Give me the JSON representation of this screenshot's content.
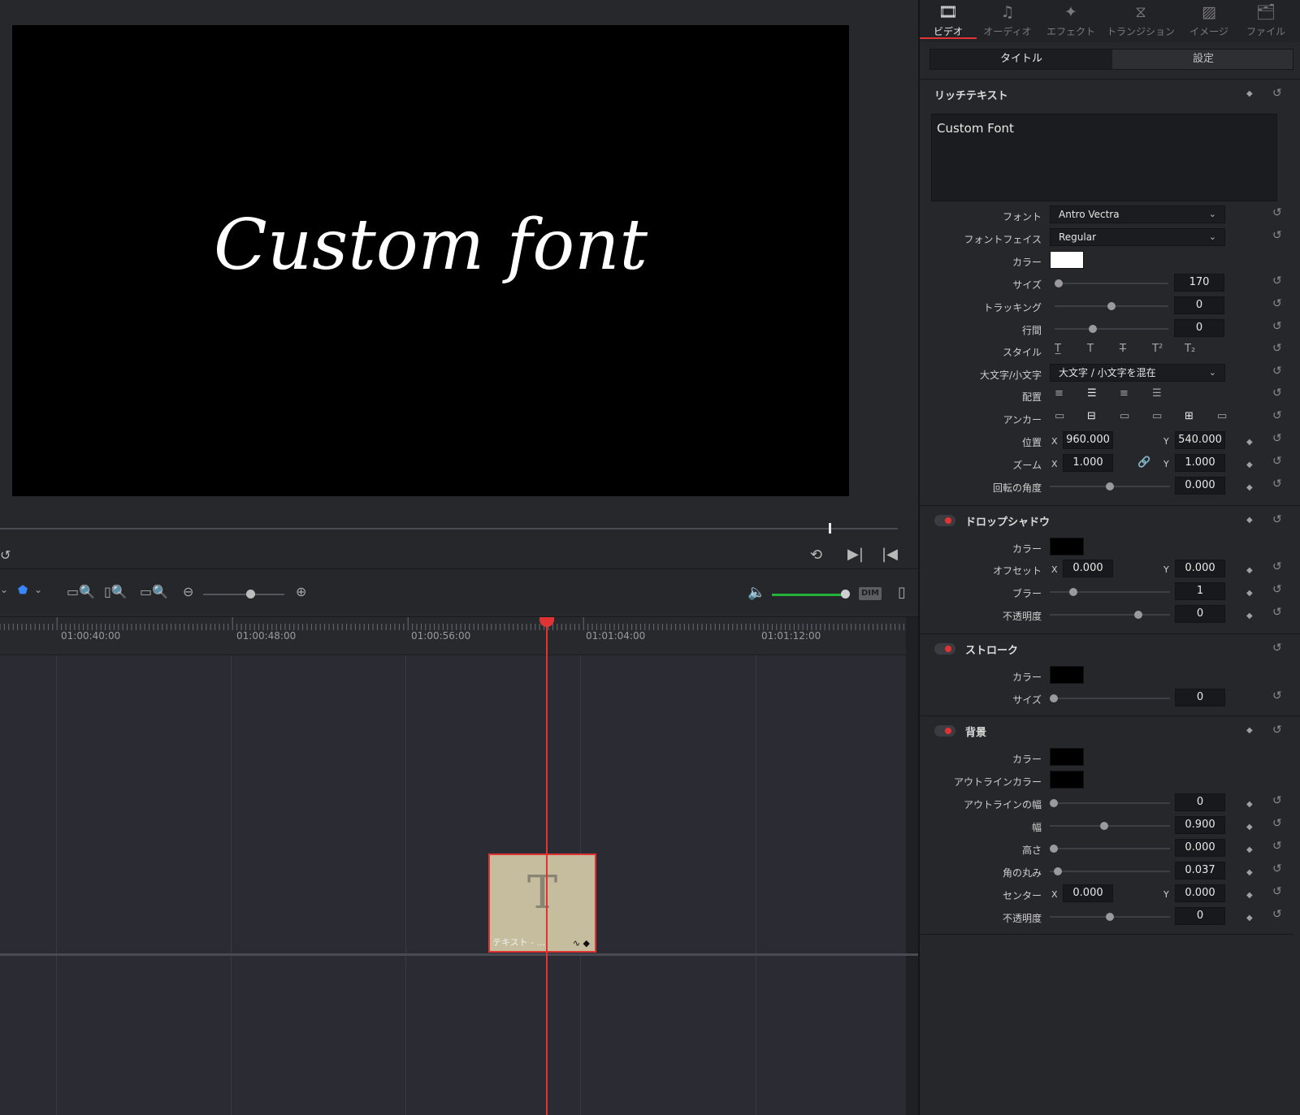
{
  "viewer": {
    "preview_text": "Custom font"
  },
  "timeline": {
    "ruler_labels": [
      "01:00:40:00",
      "01:00:48:00",
      "01:00:56:00",
      "01:01:04:00",
      "01:01:12:00"
    ],
    "clip": {
      "glyph": "T",
      "label": "テキスト - ..."
    },
    "dim_label": "DIM"
  },
  "tabs": [
    {
      "label": "ビデオ",
      "icon": "film-icon",
      "active": true
    },
    {
      "label": "オーディオ",
      "icon": "music-note-icon"
    },
    {
      "label": "エフェクト",
      "icon": "magic-wand-icon"
    },
    {
      "label": "トランジション",
      "icon": "transition-icon"
    },
    {
      "label": "イメージ",
      "icon": "image-icon"
    },
    {
      "label": "ファイル",
      "icon": "file-icon"
    }
  ],
  "subtabs": {
    "title": "タイトル",
    "settings": "設定"
  },
  "rich_text": {
    "header": "リッチテキスト",
    "content": "Custom Font",
    "font_label": "フォント",
    "font_value": "Antro Vectra",
    "face_label": "フォントフェイス",
    "face_value": "Regular",
    "color_label": "カラー",
    "color_value": "#ffffff",
    "size_label": "サイズ",
    "size_value": "170",
    "tracking_label": "トラッキング",
    "tracking_value": "0",
    "leading_label": "行間",
    "leading_value": "0",
    "style_label": "スタイル",
    "case_label": "大文字/小文字",
    "case_value": "大文字 / 小文字を混在",
    "align_label": "配置",
    "anchor_label": "アンカー",
    "position_label": "位置",
    "position_x": "960.000",
    "position_y": "540.000",
    "zoom_label": "ズーム",
    "zoom_x": "1.000",
    "zoom_y": "1.000",
    "rotation_label": "回転の角度",
    "rotation_value": "0.000",
    "axis_x": "X",
    "axis_y": "Y"
  },
  "drop_shadow": {
    "header": "ドロップシャドウ",
    "color_label": "カラー",
    "color_value": "#000000",
    "offset_label": "オフセット",
    "offset_x": "0.000",
    "offset_y": "0.000",
    "blur_label": "ブラー",
    "blur_value": "1",
    "opacity_label": "不透明度",
    "opacity_value": "0"
  },
  "stroke": {
    "header": "ストローク",
    "color_label": "カラー",
    "color_value": "#000000",
    "size_label": "サイズ",
    "size_value": "0"
  },
  "background": {
    "header": "背景",
    "color_label": "カラー",
    "color_value": "#000000",
    "outline_color_label": "アウトラインカラー",
    "outline_color_value": "#000000",
    "outline_width_label": "アウトラインの幅",
    "outline_width_value": "0",
    "width_label": "幅",
    "width_value": "0.900",
    "height_label": "高さ",
    "height_value": "0.000",
    "corner_label": "角の丸み",
    "corner_value": "0.037",
    "center_label": "センター",
    "center_x": "0.000",
    "center_y": "0.000",
    "opacity_label": "不透明度",
    "opacity_value": "0"
  },
  "colors": {
    "accent": "#e03434",
    "volume": "#23b33b"
  }
}
